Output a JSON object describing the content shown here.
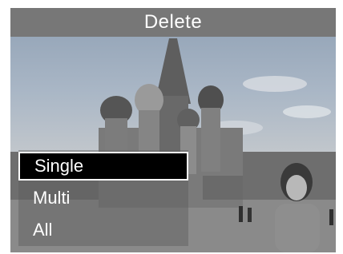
{
  "screen": {
    "title": "Delete",
    "menu": {
      "items": [
        {
          "label": "Single",
          "selected": true
        },
        {
          "label": "Multi",
          "selected": false
        },
        {
          "label": "All",
          "selected": false
        }
      ]
    }
  },
  "colors": {
    "title_bar": "#777777",
    "selected_bg": "#000000",
    "text": "#ffffff"
  }
}
